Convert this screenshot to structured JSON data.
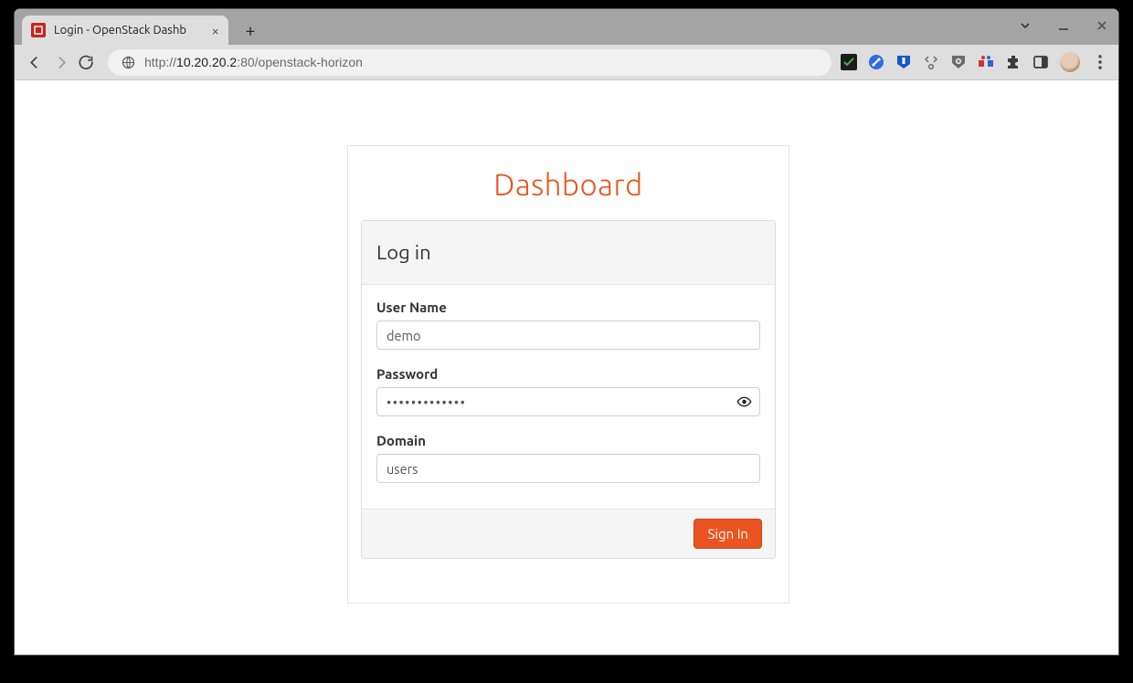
{
  "browser": {
    "tab_title": "Login - OpenStack Dashb",
    "url_prefix": "http://",
    "url_host": "10.20.20.2",
    "url_rest": ":80/openstack-horizon"
  },
  "login": {
    "brand": "Dashboard",
    "heading": "Log in",
    "username_label": "User Name",
    "username_value": "demo",
    "password_label": "Password",
    "password_value": "•••••••••••••",
    "domain_label": "Domain",
    "domain_value": "users",
    "submit_label": "Sign In"
  }
}
